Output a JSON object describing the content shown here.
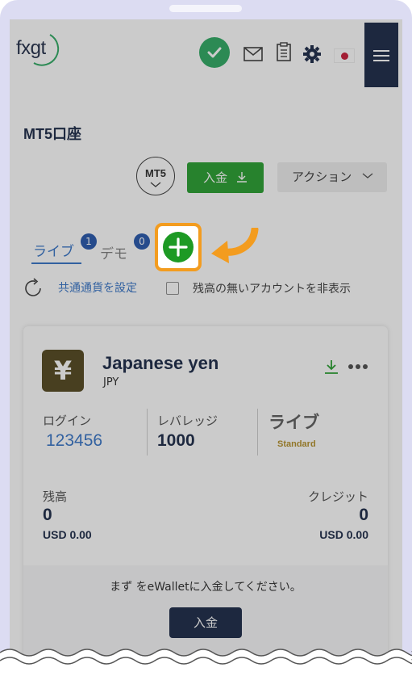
{
  "header": {
    "logo_text": "fxgt",
    "icons": [
      "check-circle-icon",
      "mail-icon",
      "clipboard-icon",
      "gear-icon",
      "japan-flag-icon",
      "hamburger-menu-icon"
    ]
  },
  "page": {
    "title": "MT5口座"
  },
  "toolbar": {
    "platform_label": "MT5",
    "deposit_label": "入金",
    "action_label": "アクション"
  },
  "tabs": [
    {
      "label": "ライブ",
      "badge": "1"
    },
    {
      "label": "デモ",
      "badge": "0"
    }
  ],
  "options": {
    "set_currency_label": "共通通貨を設定",
    "hide_empty_label": "残高の無いアカウントを非表示"
  },
  "account_card": {
    "currency_symbol": "¥",
    "currency_name": "Japanese yen",
    "currency_code": "JPY",
    "login_label": "ログイン",
    "login_value": "123456",
    "leverage_label": "レバレッジ",
    "leverage_value": "1000",
    "account_type": "ライブ",
    "account_tier": "Standard",
    "balance_label": "残高",
    "balance_value": "0",
    "balance_usd": "USD 0.00",
    "credit_label": "クレジット",
    "credit_value": "0",
    "credit_usd": "USD 0.00",
    "ewallet_message": "まず をeWalletに入金してください。",
    "deposit_button": "入金"
  },
  "colors": {
    "navy": "#0f1e3d",
    "green": "#1d9a24",
    "link_blue": "#2b6cc4",
    "highlight_orange": "#f39c1f",
    "gold": "#b08a1e"
  }
}
